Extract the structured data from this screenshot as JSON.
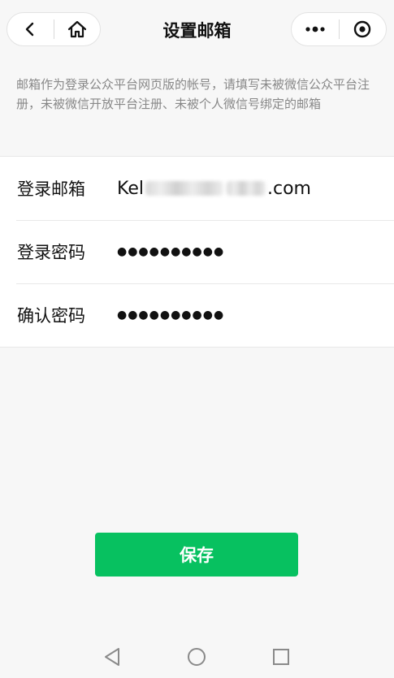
{
  "navbar": {
    "title": "设置邮箱",
    "icons": {
      "back": "back-chevron-icon",
      "home": "home-icon",
      "more": "more-dots-icon",
      "close": "target-circle-icon"
    }
  },
  "description": "邮箱作为登录公众平台网页版的帐号，请填写未被微信公众平台注册，未被微信开放平台注册、未被个人微信号绑定的邮箱",
  "form": {
    "email": {
      "label": "登录邮箱",
      "value_prefix": "Kel",
      "value_suffix": ".com"
    },
    "password": {
      "label": "登录密码",
      "value": "●●●●●●●●●●"
    },
    "confirm": {
      "label": "确认密码",
      "value": "●●●●●●●●●●"
    }
  },
  "save_label": "保存",
  "colors": {
    "accent": "#07c160",
    "background": "#f7f7f7",
    "description_text": "#888888"
  },
  "system_nav": {
    "icons": [
      "back-triangle-icon",
      "home-circle-icon",
      "recent-square-icon"
    ]
  }
}
